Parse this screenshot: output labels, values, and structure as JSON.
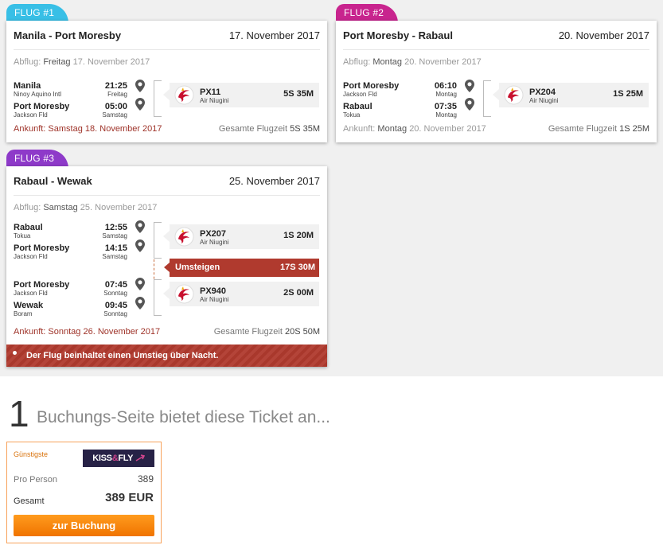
{
  "colors": {
    "tab1": "#38bfe6",
    "tab2": "#c8248e",
    "tab3": "#8e3ac9",
    "alert_red": "#b03a2e",
    "book_orange": "#f28a0c",
    "offer_border": "#f7a35c"
  },
  "flights": [
    {
      "tab": "FLUG #1",
      "route": "Manila - Port Moresby",
      "date": "17. November 2017",
      "departure_label": "Abflug:",
      "departure_weekday": "Freitag",
      "departure_date": "17. November 2017",
      "stops": [
        {
          "city": "Manila",
          "airport": "Ninoy Aquino Intl",
          "time": "21:25",
          "weekday": "Freitag"
        },
        {
          "city": "Port Moresby",
          "airport": "Jackson Fld",
          "time": "05:00",
          "weekday": "Samstag"
        }
      ],
      "segments": [
        {
          "flight_no": "PX11",
          "airline": "Air Niugini",
          "duration": "5S 35M"
        }
      ],
      "arrival_label": "Ankunft:",
      "arrival_weekday": "Samstag",
      "arrival_date": "18. November 2017",
      "total_label": "Gesamte Flugzeit",
      "total_time": "5S 35M"
    },
    {
      "tab": "FLUG #2",
      "route": "Port Moresby - Rabaul",
      "date": "20. November 2017",
      "departure_label": "Abflug:",
      "departure_weekday": "Montag",
      "departure_date": "20. November 2017",
      "stops": [
        {
          "city": "Port Moresby",
          "airport": "Jackson Fld",
          "time": "06:10",
          "weekday": "Montag"
        },
        {
          "city": "Rabaul",
          "airport": "Tokua",
          "time": "07:35",
          "weekday": "Montag"
        }
      ],
      "segments": [
        {
          "flight_no": "PX204",
          "airline": "Air Niugini",
          "duration": "1S 25M"
        }
      ],
      "arrival_label": "Ankunft:",
      "arrival_weekday": "Montag",
      "arrival_date": "20. November 2017",
      "total_label": "Gesamte Flugzeit",
      "total_time": "1S 25M"
    },
    {
      "tab": "FLUG #3",
      "route": "Rabaul - Wewak",
      "date": "25. November 2017",
      "departure_label": "Abflug:",
      "departure_weekday": "Samstag",
      "departure_date": "25. November 2017",
      "stops": [
        {
          "city": "Rabaul",
          "airport": "Tokua",
          "time": "12:55",
          "weekday": "Samstag"
        },
        {
          "city": "Port Moresby",
          "airport": "Jackson Fld",
          "time": "14:15",
          "weekday": "Samstag"
        },
        {
          "city": "Port Moresby",
          "airport": "Jackson Fld",
          "time": "07:45",
          "weekday": "Sonntag"
        },
        {
          "city": "Wewak",
          "airport": "Boram",
          "time": "09:45",
          "weekday": "Sonntag"
        }
      ],
      "segments": [
        {
          "flight_no": "PX207",
          "airline": "Air Niugini",
          "duration": "1S 20M"
        },
        {
          "flight_no": "PX940",
          "airline": "Air Niugini",
          "duration": "2S 00M"
        }
      ],
      "transfer": {
        "label": "Umsteigen",
        "duration": "17S 30M"
      },
      "arrival_label": "Ankunft:",
      "arrival_weekday": "Sonntag",
      "arrival_date": "26. November 2017",
      "total_label": "Gesamte Flugzeit",
      "total_time": "20S 50M",
      "warning": "Der Flug beinhaltet einen Umstieg über Nacht."
    }
  ],
  "offers": {
    "count": "1",
    "heading": "Buchungs-Seite bietet diese Ticket an...",
    "card": {
      "badge": "Günstigste",
      "provider_logo": {
        "part1": "KISS",
        "amp": "&",
        "part2": "FLY",
        "icon": "plane-swoosh-icon"
      },
      "per_person_label": "Pro Person",
      "per_person_value": "389",
      "total_label": "Gesamt",
      "total_value": "389 EUR",
      "book_label": "zur Buchung"
    }
  }
}
